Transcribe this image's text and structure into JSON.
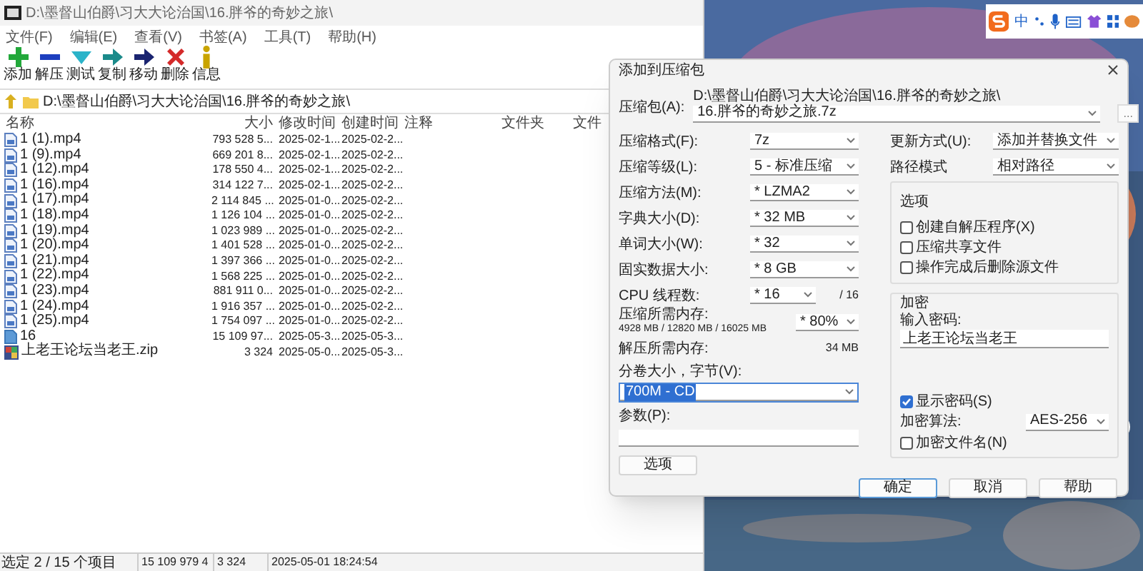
{
  "file_manager": {
    "title": "D:\\墨督山伯爵\\习大大论治国\\16.胖爷的奇妙之旅\\",
    "menu": [
      "文件(F)",
      "编辑(E)",
      "查看(V)",
      "书签(A)",
      "工具(T)",
      "帮助(H)"
    ],
    "toolbar": [
      {
        "kind": "add",
        "label": "添加"
      },
      {
        "kind": "extract",
        "label": "解压"
      },
      {
        "kind": "test",
        "label": "测试"
      },
      {
        "kind": "copy",
        "label": "复制"
      },
      {
        "kind": "move",
        "label": "移动"
      },
      {
        "kind": "delete",
        "label": "删除"
      },
      {
        "kind": "info",
        "label": "信息"
      }
    ],
    "address": "D:\\墨督山伯爵\\习大大论治国\\16.胖爷的奇妙之旅\\",
    "columns": [
      "名称",
      "大小",
      "修改时间",
      "创建时间",
      "注释",
      "文件夹",
      "文件"
    ],
    "rows": [
      {
        "kind": "video",
        "name": "1 (1).mp4",
        "size": "793 528 5...",
        "modified": "2025-02-1...",
        "created": "2025-02-2..."
      },
      {
        "kind": "video",
        "name": "1 (9).mp4",
        "size": "669 201 8...",
        "modified": "2025-02-1...",
        "created": "2025-02-2..."
      },
      {
        "kind": "video",
        "name": "1 (12).mp4",
        "size": "178 550 4...",
        "modified": "2025-02-1...",
        "created": "2025-02-2..."
      },
      {
        "kind": "video",
        "name": "1 (16).mp4",
        "size": "314 122 7...",
        "modified": "2025-02-1...",
        "created": "2025-02-2..."
      },
      {
        "kind": "video",
        "name": "1 (17).mp4",
        "size": "2 114 845 ...",
        "modified": "2025-01-0...",
        "created": "2025-02-2..."
      },
      {
        "kind": "video",
        "name": "1 (18).mp4",
        "size": "1 126 104 ...",
        "modified": "2025-01-0...",
        "created": "2025-02-2..."
      },
      {
        "kind": "video",
        "name": "1 (19).mp4",
        "size": "1 023 989 ...",
        "modified": "2025-01-0...",
        "created": "2025-02-2..."
      },
      {
        "kind": "video",
        "name": "1 (20).mp4",
        "size": "1 401 528 ...",
        "modified": "2025-01-0...",
        "created": "2025-02-2..."
      },
      {
        "kind": "video",
        "name": "1 (21).mp4",
        "size": "1 397 366 ...",
        "modified": "2025-01-0...",
        "created": "2025-02-2..."
      },
      {
        "kind": "video",
        "name": "1 (22).mp4",
        "size": "1 568 225 ...",
        "modified": "2025-01-0...",
        "created": "2025-02-2..."
      },
      {
        "kind": "video",
        "name": "1 (23).mp4",
        "size": "881 911 0...",
        "modified": "2025-01-0...",
        "created": "2025-02-2..."
      },
      {
        "kind": "video",
        "name": "1 (24).mp4",
        "size": "1 916 357 ...",
        "modified": "2025-01-0...",
        "created": "2025-02-2..."
      },
      {
        "kind": "video",
        "name": "1 (25).mp4",
        "size": "1 754 097 ...",
        "modified": "2025-01-0...",
        "created": "2025-02-2..."
      },
      {
        "kind": "file",
        "name": "16",
        "size": "15 109 97...",
        "modified": "2025-05-3...",
        "created": "2025-05-3..."
      },
      {
        "kind": "archive",
        "name": "上老王论坛当老王.zip",
        "size": "3 324",
        "modified": "2025-05-0...",
        "created": "2025-05-3..."
      }
    ],
    "status_bar": {
      "selection": "选定 2 / 15 个项目",
      "size": "15 109 979 4",
      "packed_size": "3 324",
      "modified": "2025-05-01 18:24:54"
    }
  },
  "dialog": {
    "title": "添加到压缩包",
    "archive": {
      "label": "压缩包(A):",
      "folder": "D:\\墨督山伯爵\\习大大论治国\\16.胖爷的奇妙之旅\\",
      "name": "16.胖爷的奇妙之旅.7z",
      "browse": "..."
    },
    "left_fields": [
      {
        "label": "压缩格式(F):",
        "value": "7z"
      },
      {
        "label": "压缩等级(L):",
        "value": "5 - 标准压缩"
      },
      {
        "label": "压缩方法(M):",
        "value": "* LZMA2"
      },
      {
        "label": "字典大小(D):",
        "value": "* 32 MB"
      },
      {
        "label": "单词大小(W):",
        "value": "* 32"
      },
      {
        "label": "固实数据大小:",
        "value": "* 8 GB"
      }
    ],
    "cpu": {
      "label": "CPU 线程数:",
      "value": "* 16",
      "max": "/ 16"
    },
    "memory": {
      "label": "压缩所需内存:",
      "detail": "4928 MB / 12820 MB / 16025 MB",
      "value": "* 80%"
    },
    "decompress": {
      "label": "解压所需内存:",
      "value": "34 MB"
    },
    "volume": {
      "label": "分卷大小，字节(V):",
      "value": "700M - CD"
    },
    "params": {
      "label": "参数(P):"
    },
    "options_button": "选项",
    "right_fields": [
      {
        "label": "更新方式(U):",
        "value": "添加并替换文件"
      },
      {
        "label": "路径模式",
        "value": "相对路径"
      }
    ],
    "options": {
      "title": "选项",
      "checkboxes": [
        {
          "label": "创建自解压程序(X)",
          "checked": false
        },
        {
          "label": "压缩共享文件",
          "checked": false
        },
        {
          "label": "操作完成后删除源文件",
          "checked": false
        }
      ]
    },
    "encryption": {
      "title": "加密",
      "password_label": "输入密码:",
      "password": "上老王论坛当老王",
      "show_password": {
        "label": "显示密码(S)",
        "checked": true
      },
      "method": {
        "label": "加密算法:",
        "value": "AES-256"
      },
      "encrypt_names": {
        "label": "加密文件名(N)",
        "checked": false
      }
    },
    "buttons": [
      {
        "label": "确定",
        "default": true
      },
      {
        "label": "取消",
        "default": false
      },
      {
        "label": "帮助",
        "default": false
      }
    ]
  },
  "tray": {
    "ime_mode": "中"
  }
}
